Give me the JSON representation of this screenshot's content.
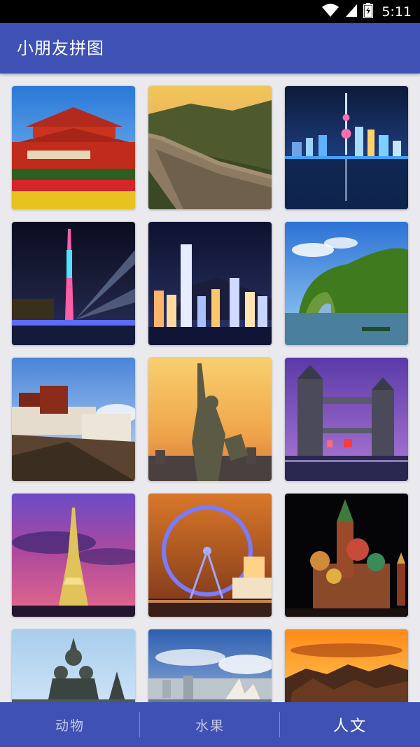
{
  "status_bar": {
    "time": "5:11",
    "icons": [
      "wifi-icon",
      "signal-icon",
      "battery-charging-icon"
    ]
  },
  "app_bar": {
    "title": "小朋友拼图"
  },
  "grid": {
    "tiles": [
      {
        "subject": "tiananmen",
        "icon": "tiananmen-image"
      },
      {
        "subject": "great-wall",
        "icon": "great-wall-image"
      },
      {
        "subject": "shanghai-skyline",
        "icon": "shanghai-skyline-image"
      },
      {
        "subject": "canton-tower",
        "icon": "canton-tower-image"
      },
      {
        "subject": "hong-kong-skyline",
        "icon": "hong-kong-skyline-image"
      },
      {
        "subject": "elephant-trunk-hill",
        "icon": "elephant-trunk-hill-image"
      },
      {
        "subject": "potala-palace",
        "icon": "potala-palace-image"
      },
      {
        "subject": "statue-of-liberty",
        "icon": "statue-of-liberty-image"
      },
      {
        "subject": "tower-bridge",
        "icon": "tower-bridge-image"
      },
      {
        "subject": "eiffel-tower",
        "icon": "eiffel-tower-image"
      },
      {
        "subject": "london-eye",
        "icon": "london-eye-image"
      },
      {
        "subject": "saint-basils-cathedral",
        "icon": "saint-basils-cathedral-image"
      },
      {
        "subject": "wooden-church",
        "icon": "wooden-church-image"
      },
      {
        "subject": "sydney-opera-house",
        "icon": "sydney-opera-house-image"
      },
      {
        "subject": "sunset-village",
        "icon": "sunset-village-image"
      }
    ]
  },
  "bottom_nav": {
    "tabs": [
      {
        "label": "动物",
        "active": false
      },
      {
        "label": "水果",
        "active": false
      },
      {
        "label": "人文",
        "active": true
      }
    ]
  },
  "colors": {
    "primary": "#3f51b5",
    "background": "#e9e9ee",
    "inactive_tab_text": "#c5cae9",
    "active_tab_text": "#ffffff"
  }
}
